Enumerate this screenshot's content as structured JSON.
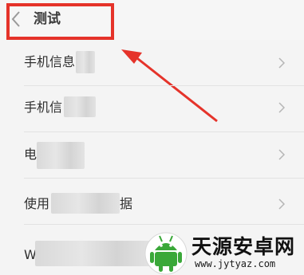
{
  "header": {
    "title": "测试"
  },
  "list": {
    "items": [
      {
        "label": "手机信息"
      },
      {
        "label": "手机信"
      },
      {
        "label": "电"
      },
      {
        "label": "使用",
        "suffix": "据"
      },
      {
        "label": "W"
      }
    ]
  },
  "watermark": {
    "name": "天源安卓网",
    "url": "www.jytyaz.com"
  },
  "colors": {
    "annotation_red": "#e5332a",
    "background": "#f4f4f4",
    "watermark_green": "#3aa839"
  }
}
